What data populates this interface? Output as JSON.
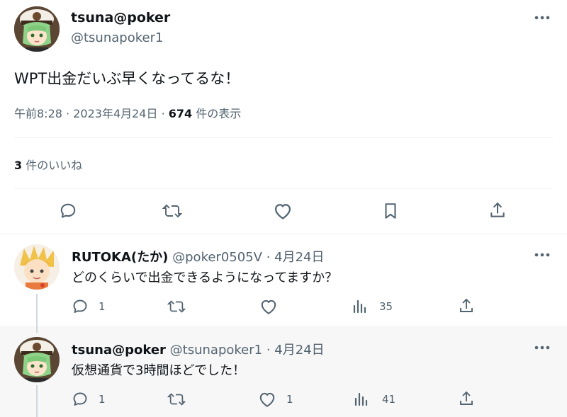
{
  "main_tweet": {
    "name": "tsuna@poker",
    "handle": "@tsunapoker1",
    "text": "WPT出金だいぶ早くなってるな！",
    "time": "午前8:28",
    "sep1": "·",
    "date": "2023年4月24日",
    "sep2": "·",
    "views_count": "674",
    "views_label": " 件の表示",
    "likes_count": "3",
    "likes_label": " 件のいいね"
  },
  "replies": [
    {
      "name": "RUTOKA(たか)",
      "handle": "@poker0505V",
      "sep": "·",
      "date": "4月24日",
      "text": "どのくらいで出金できるようになってますか？",
      "reply_count": "1",
      "retweet_count": "",
      "like_count": "",
      "views_count": "35"
    },
    {
      "name": "tsuna@poker",
      "handle": "@tsunapoker1",
      "sep": "·",
      "date": "4月24日",
      "text": "仮想通貨で3時間ほどでした！",
      "reply_count": "1",
      "retweet_count": "",
      "like_count": "1",
      "views_count": "41"
    }
  ],
  "icons": [
    "more-icon",
    "reply-icon",
    "retweet-icon",
    "like-icon",
    "bookmark-icon",
    "share-icon",
    "views-icon"
  ],
  "colors": {
    "text": "#0f1419",
    "muted": "#536471",
    "divider": "#eff3f4",
    "thread_line": "#cfd9de",
    "highlight_bg": "#f7f7f7"
  }
}
